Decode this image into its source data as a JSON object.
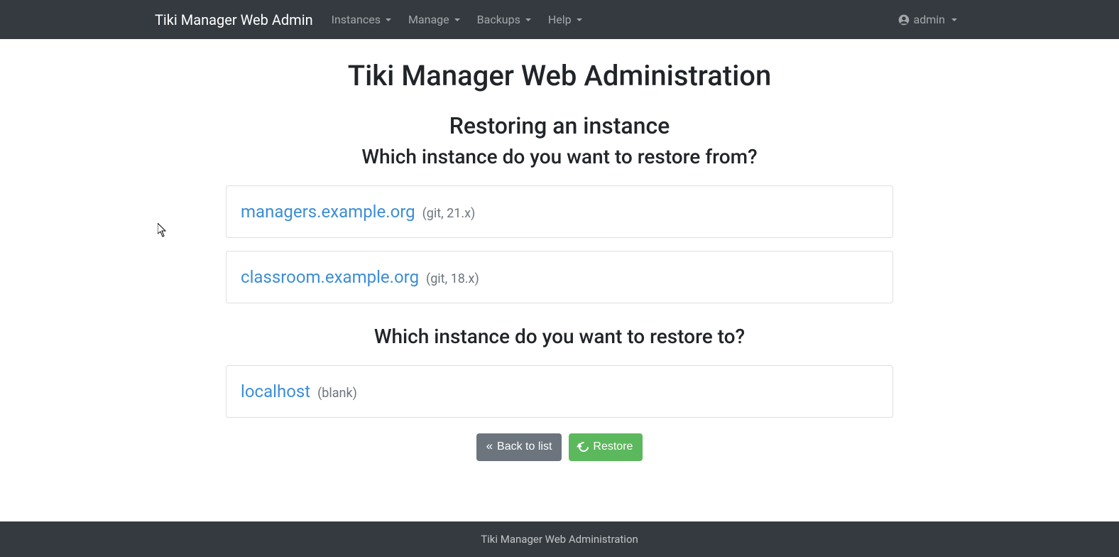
{
  "navbar": {
    "brand": "Tiki Manager Web Admin",
    "items": [
      {
        "label": "Instances"
      },
      {
        "label": "Manage"
      },
      {
        "label": "Backups"
      },
      {
        "label": "Help"
      }
    ],
    "user_label": "admin"
  },
  "page": {
    "title": "Tiki Manager Web Administration",
    "subtitle": "Restoring an instance",
    "prompt_from": "Which instance do you want to restore from?",
    "prompt_to": "Which instance do you want to restore to?"
  },
  "from_instances": [
    {
      "name": "managers.example.org",
      "meta": "(git, 21.x)"
    },
    {
      "name": "classroom.example.org",
      "meta": "(git, 18.x)"
    }
  ],
  "to_instances": [
    {
      "name": "localhost",
      "meta": "(blank)"
    }
  ],
  "actions": {
    "back_label": "Back to list",
    "restore_label": "Restore"
  },
  "footer": {
    "text": "Tiki Manager Web Administration"
  }
}
